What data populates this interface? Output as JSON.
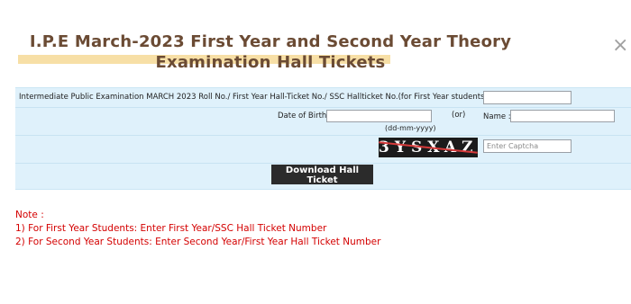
{
  "header": {
    "title_line1": "I.P.E March-2023 First Year and Second Year Theory",
    "title_line2": "Examination Hall Tickets",
    "close_glyph": "×"
  },
  "form": {
    "rollno_label": "Intermediate Public Examination MARCH 2023 Roll No./ First Year Hall-Ticket No./ SSC Hallticket No.(for First Year students)",
    "rollno_value": "",
    "dob_label": "Date of Birth :",
    "dob_value": "",
    "dob_format": "(dd-mm-yyyy)",
    "or_label": "(or)",
    "name_label": "Name :",
    "name_value": "",
    "captcha_text": "3YSXAZ",
    "captcha_placeholder": "Enter Captcha",
    "download_button": "Download Hall Ticket"
  },
  "notes": {
    "heading": "Note :",
    "items": [
      "1) For First Year Students: Enter First Year/SSC Hall Ticket Number",
      "2) For Second Year Students: Enter Second Year/First Year Hall Ticket Number"
    ]
  },
  "colors": {
    "title": "#6b4b34",
    "highlight": "#f7dfa6",
    "form_bg": "#dff1fb",
    "button_bg": "#2b2b2b",
    "note_text": "#d40000"
  }
}
